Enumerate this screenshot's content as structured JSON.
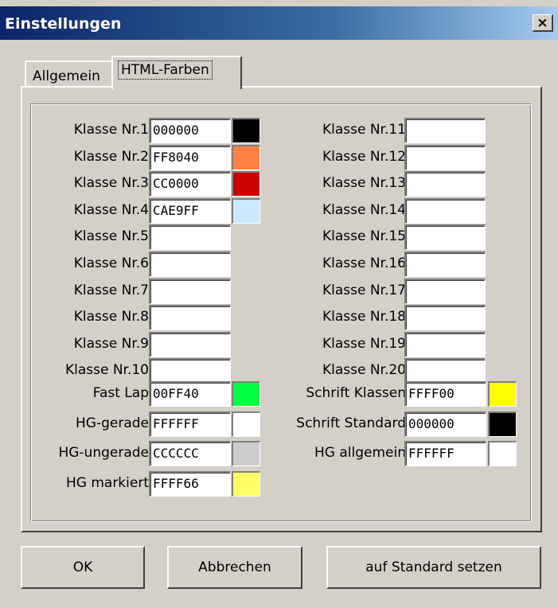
{
  "window": {
    "title": "Einstellungen",
    "close": "×"
  },
  "tabs": {
    "general": "Allgemein",
    "html_colors": "HTML-Farben"
  },
  "left_rows": [
    {
      "label": "Klasse Nr.1",
      "value": "000000",
      "color": "#000000"
    },
    {
      "label": "Klasse Nr.2",
      "value": "FF8040",
      "color": "#ff8040"
    },
    {
      "label": "Klasse Nr.3",
      "value": "CC0000",
      "color": "#cc0000"
    },
    {
      "label": "Klasse Nr.4",
      "value": "CAE9FF",
      "color": "#cae9ff"
    },
    {
      "label": "Klasse Nr.5",
      "value": "",
      "color": ""
    },
    {
      "label": "Klasse Nr.6",
      "value": "",
      "color": ""
    },
    {
      "label": "Klasse Nr.7",
      "value": "",
      "color": ""
    },
    {
      "label": "Klasse Nr.8",
      "value": "",
      "color": ""
    },
    {
      "label": "Klasse Nr.9",
      "value": "",
      "color": ""
    },
    {
      "label": "Klasse Nr.10",
      "value": "",
      "color": ""
    }
  ],
  "right_rows": [
    {
      "label": "Klasse Nr.11",
      "value": ""
    },
    {
      "label": "Klasse Nr.12",
      "value": ""
    },
    {
      "label": "Klasse Nr.13",
      "value": ""
    },
    {
      "label": "Klasse Nr.14",
      "value": ""
    },
    {
      "label": "Klasse Nr.15",
      "value": ""
    },
    {
      "label": "Klasse Nr.16",
      "value": ""
    },
    {
      "label": "Klasse Nr.17",
      "value": ""
    },
    {
      "label": "Klasse Nr.18",
      "value": ""
    },
    {
      "label": "Klasse Nr.19",
      "value": ""
    },
    {
      "label": "Klasse Nr.20",
      "value": ""
    }
  ],
  "special_left": [
    {
      "label": "Fast Lap",
      "value": "00FF40",
      "color": "#00ff40"
    },
    {
      "label": "HG-gerade",
      "value": "FFFFFF",
      "color": "#ffffff"
    },
    {
      "label": "HG-ungerade",
      "value": "CCCCCC",
      "color": "#cccccc"
    },
    {
      "label": "HG markiert",
      "value": "FFFF66",
      "color": "#ffff66"
    }
  ],
  "special_right": [
    {
      "label": "Schrift Klassen",
      "value": "FFFF00",
      "color": "#ffff00"
    },
    {
      "label": "Schrift Standard",
      "value": "000000",
      "color": "#000000"
    },
    {
      "label": "HG allgemein",
      "value": "FFFFFF",
      "color": "#ffffff"
    }
  ],
  "buttons": {
    "ok": "OK",
    "cancel": "Abbrechen",
    "reset": "auf Standard setzen"
  }
}
